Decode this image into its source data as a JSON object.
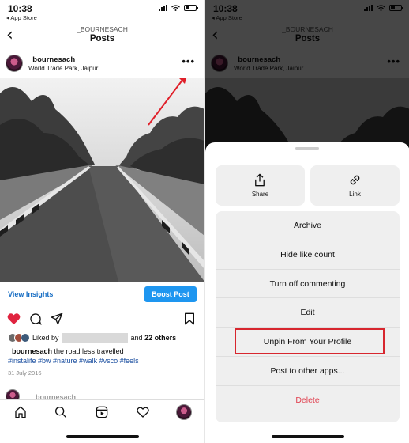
{
  "status": {
    "time": "10:38",
    "carrier": "◂ App Store"
  },
  "header": {
    "username": "_BOURNESACH",
    "title": "Posts"
  },
  "post": {
    "username": "_bournesach",
    "location": "World Trade Park, Jaipur",
    "more_glyph": "•••",
    "insights_label": "View Insights",
    "boost_label": "Boost Post",
    "liked_by_prefix": "Liked by",
    "liked_by_and": "and",
    "liked_by_count": "22 others",
    "caption_user": "_bournesach",
    "caption_text": " the road less travelled",
    "hashtags": "#instalife #bw #nature #walk #vsco #feels",
    "date": "31 July 2016"
  },
  "next_post": {
    "username": "_bournesach"
  },
  "icons": {
    "heart": "heart-icon",
    "comment": "comment-icon",
    "share": "send-icon",
    "save": "bookmark-icon",
    "home": "home-icon",
    "search": "search-icon",
    "reels": "reels-icon",
    "activity": "heart-outline-icon"
  },
  "sheet": {
    "share_label": "Share",
    "link_label": "Link",
    "items": [
      {
        "label": "Archive"
      },
      {
        "label": "Hide like count"
      },
      {
        "label": "Turn off commenting"
      },
      {
        "label": "Edit"
      },
      {
        "label": "Unpin From Your Profile"
      },
      {
        "label": "Post to other apps..."
      },
      {
        "label": "Delete"
      }
    ]
  },
  "colors": {
    "accent_blue": "#1e96f0",
    "like_red": "#e0233f",
    "delete_red": "#e0404f",
    "highlight_red": "#d7262e"
  }
}
